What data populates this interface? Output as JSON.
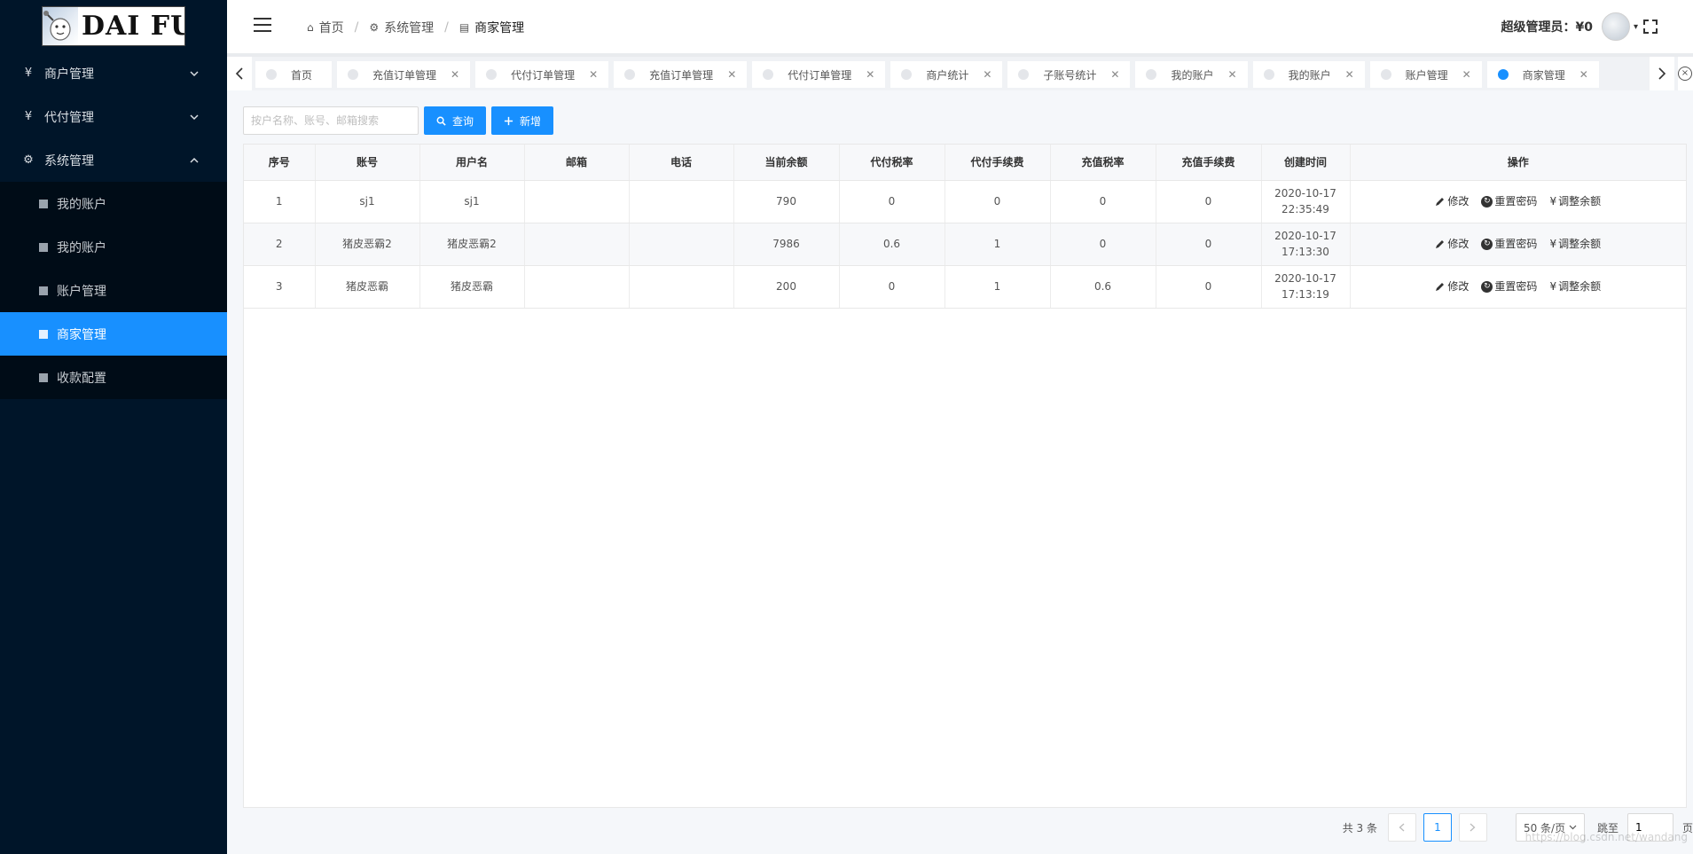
{
  "logo": {
    "text": "DAI FU"
  },
  "sidebar": {
    "groups": [
      {
        "icon": "¥",
        "label": "商户管理",
        "expanded": false
      },
      {
        "icon": "¥",
        "label": "代付管理",
        "expanded": false
      },
      {
        "icon": "⚙",
        "label": "系统管理",
        "expanded": true
      }
    ],
    "sub_items": [
      {
        "label": "我的账户",
        "active": false
      },
      {
        "label": "我的账户",
        "active": false
      },
      {
        "label": "账户管理",
        "active": false
      },
      {
        "label": "商家管理",
        "active": true
      },
      {
        "label": "收款配置",
        "active": false
      }
    ]
  },
  "header": {
    "breadcrumb": [
      "首页",
      "系统管理",
      "商家管理"
    ],
    "admin_label": "超级管理员：¥0"
  },
  "tabs": [
    {
      "label": "首页",
      "closable": false,
      "active": false
    },
    {
      "label": "充值订单管理",
      "closable": true,
      "active": false
    },
    {
      "label": "代付订单管理",
      "closable": true,
      "active": false
    },
    {
      "label": "充值订单管理",
      "closable": true,
      "active": false
    },
    {
      "label": "代付订单管理",
      "closable": true,
      "active": false
    },
    {
      "label": "商户统计",
      "closable": true,
      "active": false
    },
    {
      "label": "子账号统计",
      "closable": true,
      "active": false
    },
    {
      "label": "我的账户",
      "closable": true,
      "active": false
    },
    {
      "label": "我的账户",
      "closable": true,
      "active": false
    },
    {
      "label": "账户管理",
      "closable": true,
      "active": false
    },
    {
      "label": "商家管理",
      "closable": true,
      "active": true
    }
  ],
  "search": {
    "placeholder": "按户名称、账号、邮箱搜索",
    "query_label": "查询",
    "add_label": "新增"
  },
  "table": {
    "columns": [
      "序号",
      "账号",
      "用户名",
      "邮箱",
      "电话",
      "当前余额",
      "代付税率",
      "代付手续费",
      "充值税率",
      "充值手续费",
      "创建时间",
      "操作"
    ],
    "rows": [
      {
        "idx": "1",
        "account": "sj1",
        "username": "sj1",
        "email": "",
        "phone": "",
        "balance": "790",
        "payout_rate": "0",
        "payout_fee": "0",
        "recharge_rate": "0",
        "recharge_fee": "0",
        "created_date": "2020-10-17",
        "created_time": "22:35:49"
      },
      {
        "idx": "2",
        "account": "猪皮恶霸2",
        "username": "猪皮恶霸2",
        "email": "",
        "phone": "",
        "balance": "7986",
        "payout_rate": "0.6",
        "payout_fee": "1",
        "recharge_rate": "0",
        "recharge_fee": "0",
        "created_date": "2020-10-17",
        "created_time": "17:13:30"
      },
      {
        "idx": "3",
        "account": "猪皮恶霸",
        "username": "猪皮恶霸",
        "email": "",
        "phone": "",
        "balance": "200",
        "payout_rate": "0",
        "payout_fee": "1",
        "recharge_rate": "0.6",
        "recharge_fee": "0",
        "created_date": "2020-10-17",
        "created_time": "17:13:19"
      }
    ],
    "actions": {
      "edit": "修改",
      "reset": "重置密码",
      "adjust": "调整余额"
    }
  },
  "pagination": {
    "total_label": "共 3 条",
    "current_page": "1",
    "page_size": "50 条/页",
    "jump_label": "跳至",
    "jump_value": "1",
    "page_suffix": "页"
  },
  "watermark": "https://blog.csdn.net/wandang"
}
